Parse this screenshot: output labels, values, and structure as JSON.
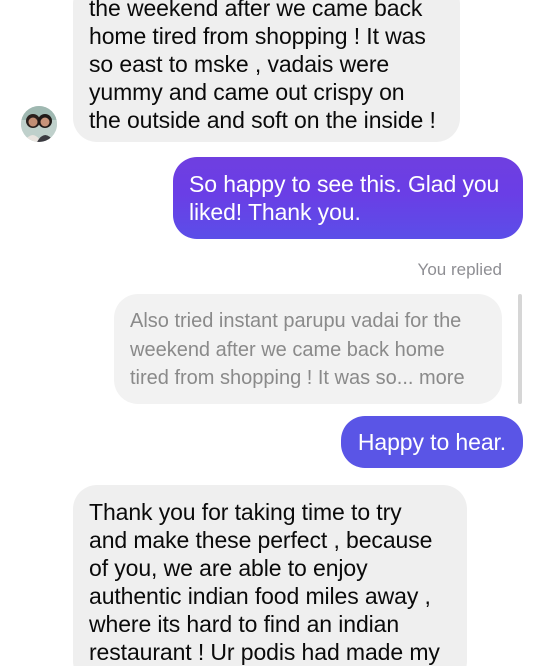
{
  "thread": {
    "incoming_1": {
      "lines": [
        "the weekend after we came back",
        "home tired from shopping ! It was",
        "so east to mske , vadais were",
        "yummy and came out crispy on",
        "the outside and soft on the inside !"
      ]
    },
    "outgoing_1": {
      "lines": [
        "So happy to see this. Glad you",
        "liked! Thank you."
      ]
    },
    "reply_meta": "You replied",
    "quoted_reply": {
      "lines": [
        "Also tried instant parupu vadai for the",
        "weekend after we came back home",
        "tired from shopping ! It was so... more"
      ]
    },
    "outgoing_2": {
      "text": "Happy to hear."
    },
    "incoming_2": {
      "lines": [
        "Thank you for taking time to try",
        "and make these perfect , because",
        "of you, we are able to enjoy",
        "authentic indian food miles away ,",
        "where its hard to find an indian",
        "restaurant ! Ur podis had made my"
      ]
    }
  },
  "colors": {
    "incoming_bubble": "#efefef",
    "outgoing_bubble_purple": "#6f3fe0",
    "outgoing_bubble_blue": "#5a55e6",
    "meta_text": "#8e8e93"
  }
}
